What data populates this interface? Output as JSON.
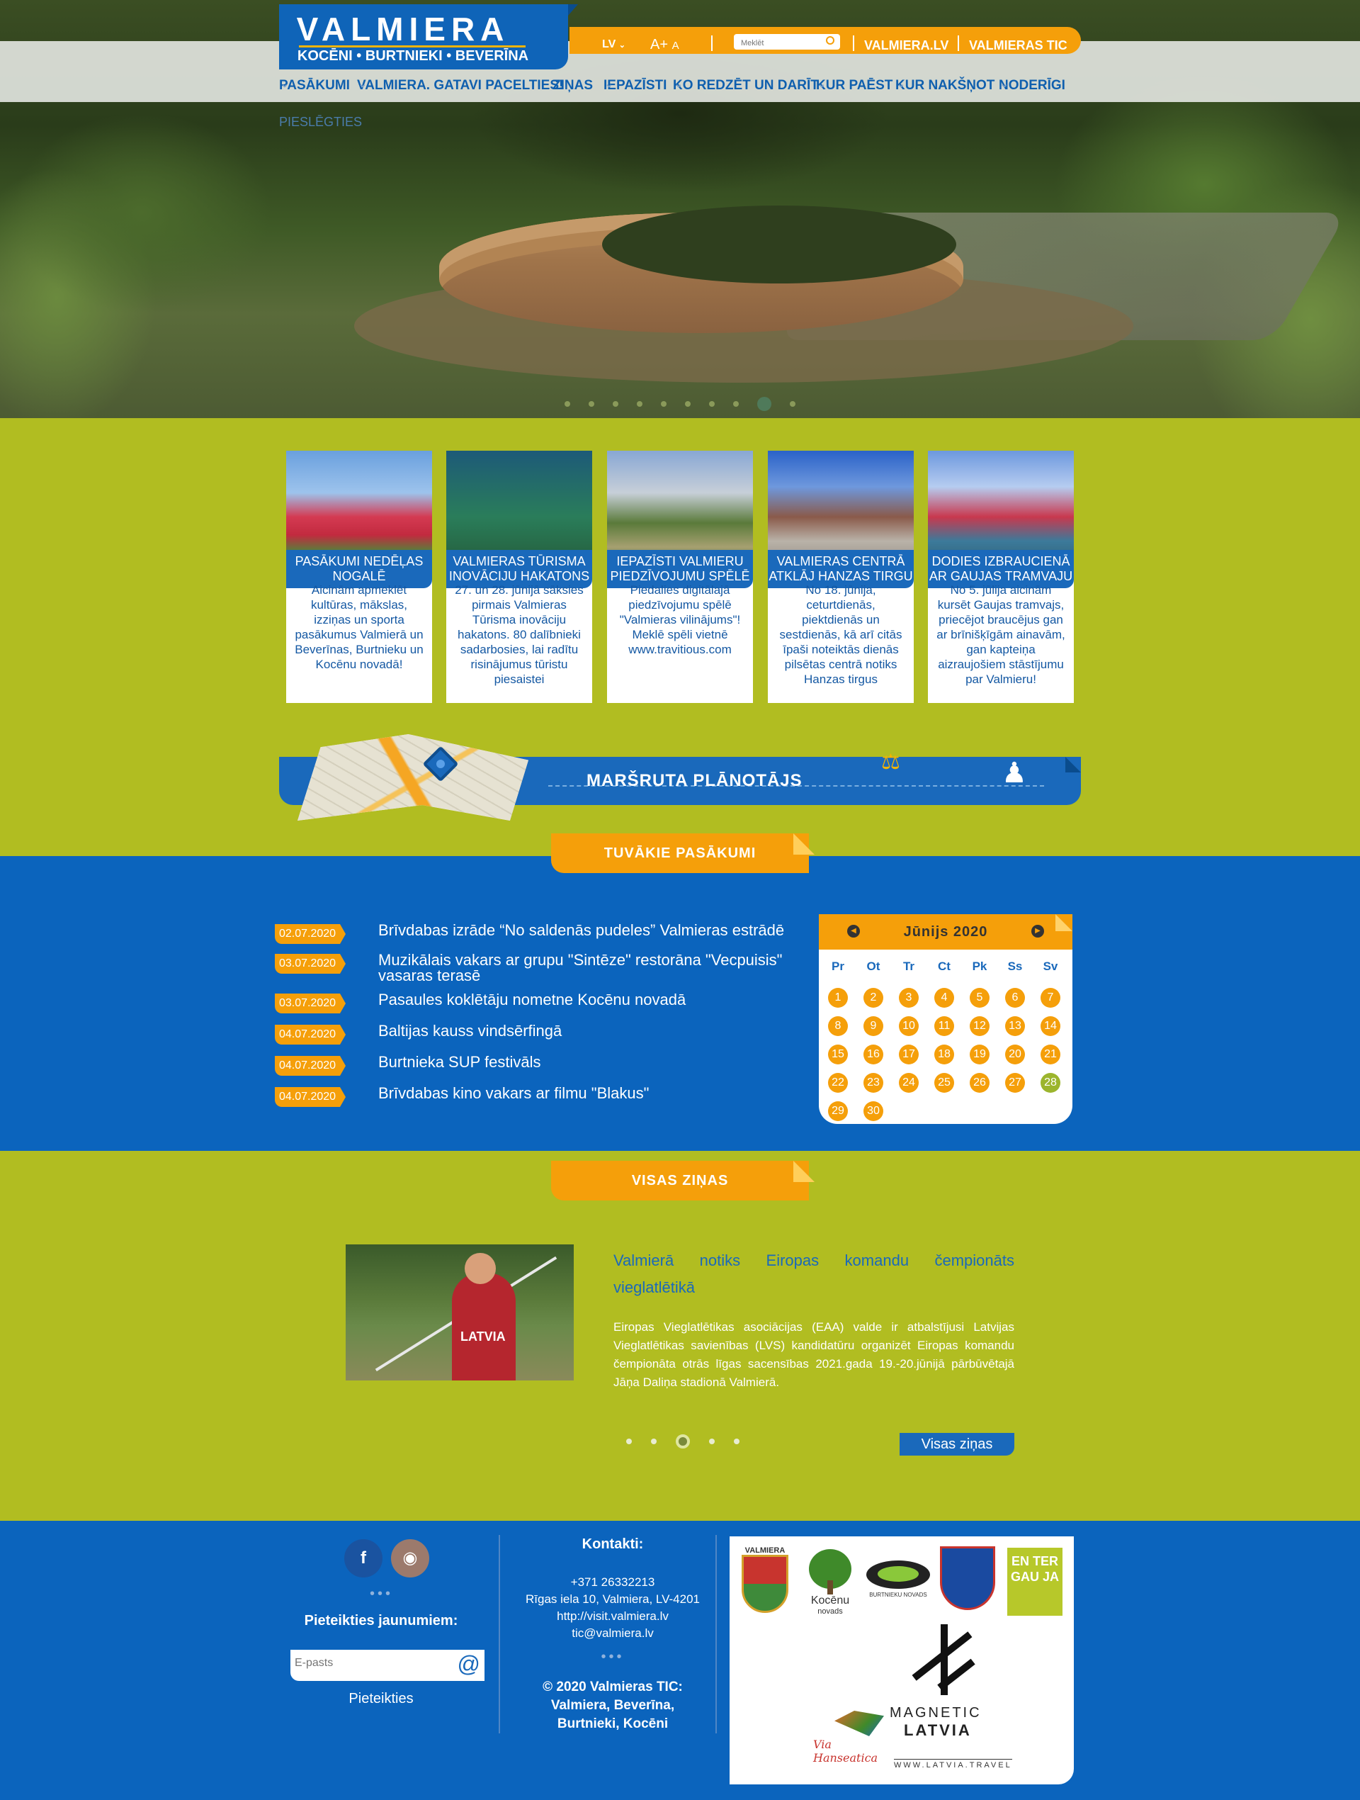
{
  "logo": {
    "name": "VALMIERA",
    "sub": "KOCĒNI • BURTNIEKI • BEVERĪNA"
  },
  "topbar": {
    "lang": "LV",
    "font_large": "A+",
    "font_small": "A",
    "search_placeholder": "Meklēt",
    "link1": "VALMIERA.LV",
    "link2": "VALMIERAS TIC"
  },
  "nav": [
    {
      "label": "PASĀKUMI"
    },
    {
      "label": "VALMIERA. GATAVI PACELTIES!"
    },
    {
      "label": "ZIŅAS"
    },
    {
      "label": "IEPAZĪSTI"
    },
    {
      "label": "KO REDZĒT UN DARĪT"
    },
    {
      "label": "KUR PAĒST"
    },
    {
      "label": "KUR NAKŠŅOT"
    },
    {
      "label": "NODERĪGI"
    }
  ],
  "breadcrumb": "PIESLĒGTIES",
  "cards": [
    {
      "title": "PASĀKUMI NEDĒĻAS NOGALĒ",
      "text": "Aicinām apmeklēt kultūras, mākslas, izziņas un sporta pasākumus Valmierā un Beverīnas, Burtnieku un Kocēnu novadā!"
    },
    {
      "title": "VALMIERAS TŪRISMA INOVĀCIJU HAKATONS",
      "text": "27. un 28. jūnijā sāksies pirmais Valmieras Tūrisma inovāciju hakatons. 80 dalībnieki sadarbosies, lai radītu risinājumus tūristu piesaistei"
    },
    {
      "title": "IEPAZĪSTI VALMIERU PIEDZĪVOJUMU SPĒLĒ",
      "text": "Piedalies digitālajā piedzīvojumu spēlē \"Valmieras vilinājums\"! Meklē spēli vietnē www.travitious.com"
    },
    {
      "title": "VALMIERAS CENTRĀ ATKLĀJ HANZAS TIRGU",
      "text": "No 18. jūnija, ceturtdienās, piektdienās un sestdienās, kā arī citās īpaši noteiktās dienās pilsētas centrā notiks Hanzas tirgus"
    },
    {
      "title": "DODIES IZBRAUCIENĀ AR GAUJAS TRAMVAJU",
      "text": "No 5. jūlija aicinām kursēt Gaujas tramvajs, priecējot braucējus gan ar brīnišķīgām ainavām, gan kapteiņa aizraujošiem stāstījumu par Valmieru!"
    }
  ],
  "route_planner": "MARŠRUTA PLĀNOTĀJS",
  "events_tab": "TUVĀKIE PASĀKUMI",
  "events": [
    {
      "date": "02.07.2020",
      "title": "Brīvdabas izrāde “No saldenās pudeles” Valmieras estrādē"
    },
    {
      "date": "03.07.2020",
      "title": "Muzikālais vakars ar grupu \"Sintēze\" restorāna \"Vecpuisis\" vasaras terasē"
    },
    {
      "date": "03.07.2020",
      "title": "Pasaules koklētāju nometne Kocēnu novadā"
    },
    {
      "date": "04.07.2020",
      "title": "Baltijas kauss vindsērfingā"
    },
    {
      "date": "04.07.2020",
      "title": "Burtnieka SUP festivāls"
    },
    {
      "date": "04.07.2020",
      "title": "Brīvdabas kino vakars ar filmu \"Blakus\""
    }
  ],
  "calendar": {
    "month": "Jūnijs 2020",
    "weekdays": [
      "Pr",
      "Ot",
      "Tr",
      "Ct",
      "Pk",
      "Ss",
      "Sv"
    ],
    "days": [
      "1",
      "2",
      "3",
      "4",
      "5",
      "6",
      "7",
      "8",
      "9",
      "10",
      "11",
      "12",
      "13",
      "14",
      "15",
      "16",
      "17",
      "18",
      "19",
      "20",
      "21",
      "22",
      "23",
      "24",
      "25",
      "26",
      "27",
      "28",
      "29",
      "30"
    ],
    "today": "28"
  },
  "news_tab": "VISAS ZIŅAS",
  "news": {
    "title": "Valmierā notiks Eiropas komandu čempionāts vieglatlētikā",
    "text": "Eiropas Vieglatlētikas asociācijas (EAA) valde ir atbalstījusi Latvijas Vieglatlētikas savienības (LVS) kandidatūru organizēt Eiropas komandu čempionāta otrās līgas sacensības 2021.gada 19.-20.jūnijā pārbūvētajā Jāņa Daliņa stadionā Valmierā.",
    "image_text": "LATVIA",
    "all_news": "Visas ziņas"
  },
  "footer": {
    "subscribe_title": "Pieteikties jaunumiem:",
    "email_placeholder": "E-pasts",
    "subscribe_btn": "Pieteikties",
    "contacts_title": "Kontakti:",
    "phone": "+371 26332213",
    "address": "Rīgas iela 10, Valmiera, LV-4201",
    "site": "http://visit.valmiera.lv",
    "email": "tic@valmiera.lv",
    "copyright_1": "© 2020 Valmieras TIC:",
    "copyright_2": "Valmiera, Beverīna,",
    "copyright_3": "Burtnieki, Kocēni",
    "partner1": "VALMIERA",
    "partner2": "Kocēnu",
    "partner2b": "novads",
    "partner3": "BURTNIEKU NOVADS",
    "partner5": "EN TER GAU JA",
    "magnetic_1": "MAGNETIC",
    "magnetic_2": "LATVIA",
    "latvia_travel": "WWW.LATVIA.TRAVEL",
    "hanseatica": "Via Hanseatica"
  },
  "colors": {
    "green": "#b1bd21",
    "blue": "#0b64bd",
    "orange": "#f59f0a"
  }
}
